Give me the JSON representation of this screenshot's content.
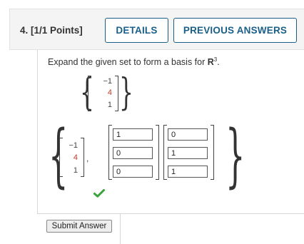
{
  "question": {
    "number_label": "4.  [1/1 Points]",
    "details_label": "DETAILS",
    "previous_answers_label": "PREVIOUS ANSWERS"
  },
  "prompt": {
    "lead": "Expand the given set to form a basis for ",
    "space": "R",
    "exponent": "3",
    "tail": "."
  },
  "given_vector": [
    "−1",
    "4",
    "1"
  ],
  "answer": {
    "vector1": [
      "−1",
      "4",
      "1"
    ],
    "vector2": [
      "1",
      "0",
      "0"
    ],
    "vector3": [
      "0",
      "1",
      "1"
    ],
    "comma": ","
  },
  "status": "correct",
  "submit_label": "Submit Answer",
  "colors": {
    "accent": "#1a5f88",
    "highlight": "#c0392b",
    "check": "#3aa33a"
  }
}
